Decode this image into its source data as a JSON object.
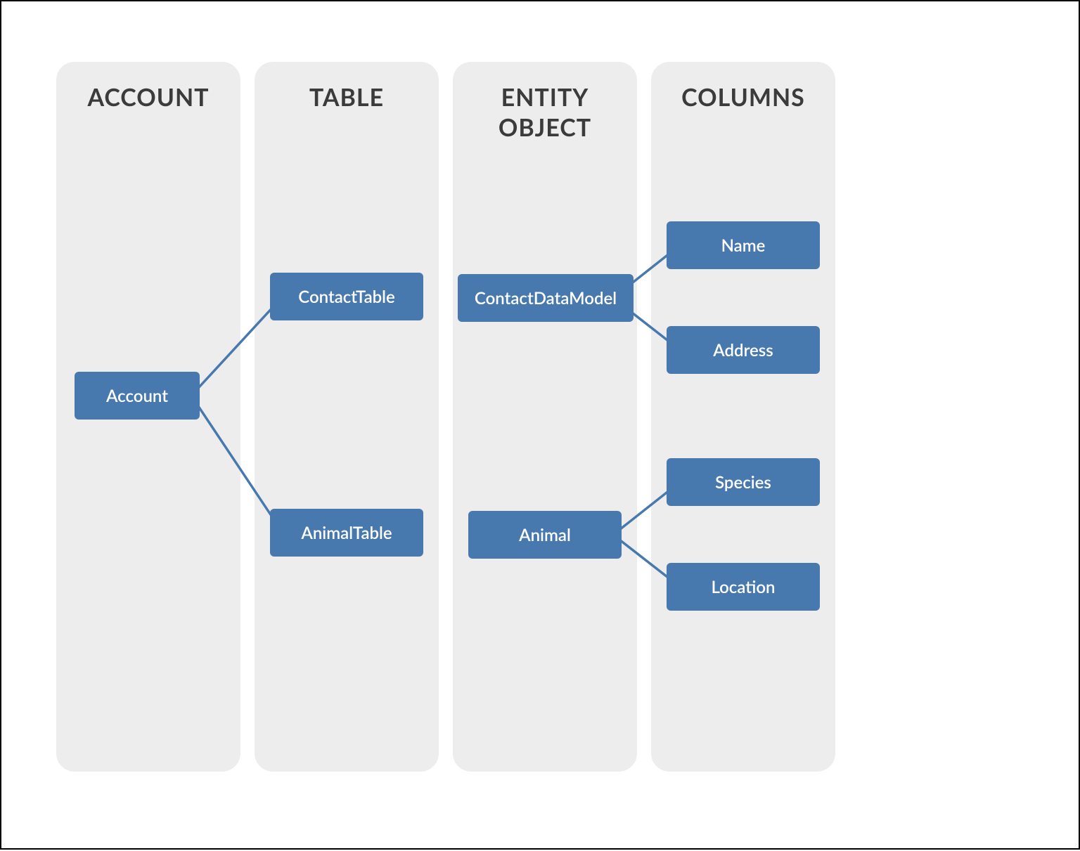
{
  "columns": {
    "account": {
      "title": "ACCOUNT"
    },
    "table": {
      "title": "TABLE"
    },
    "entity": {
      "title": "ENTITY\nOBJECT"
    },
    "columns": {
      "title": "COLUMNS"
    }
  },
  "nodes": {
    "account": {
      "label": "Account"
    },
    "contact_table": {
      "label": "ContactTable"
    },
    "animal_table": {
      "label": "AnimalTable"
    },
    "contact_data_model": {
      "label": "ContactDataModel"
    },
    "animal": {
      "label": "Animal"
    },
    "name": {
      "label": "Name"
    },
    "address": {
      "label": "Address"
    },
    "species": {
      "label": "Species"
    },
    "location": {
      "label": "Location"
    }
  },
  "colors": {
    "column_bg": "#ededed",
    "node_bg": "#4879AE",
    "node_text": "#ffffff",
    "title_text": "#3b3b3b"
  }
}
